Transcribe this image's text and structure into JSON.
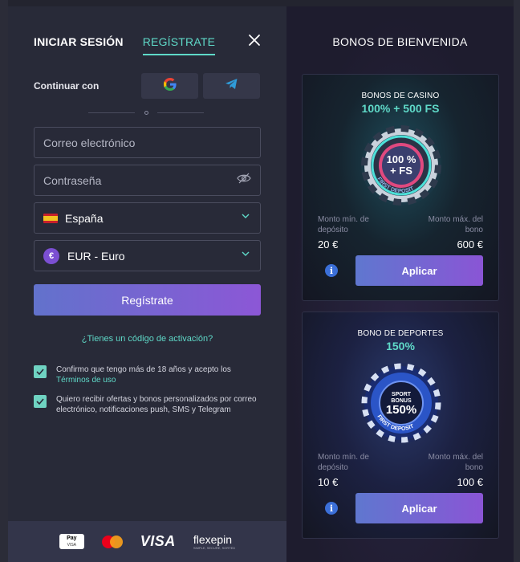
{
  "colors": {
    "accent_teal": "#5fd9c8",
    "button_gradient_start": "#6272cc",
    "button_gradient_end": "#8c57d6",
    "panel_bg": "#282a38"
  },
  "tabs": {
    "login": "INICIAR SESIÓN",
    "register": "REGÍSTRATE"
  },
  "icons": {
    "close": "close-icon",
    "google": "google-icon",
    "telegram": "telegram-icon",
    "eye": "eye-off-icon",
    "chevron": "chevron-down-icon",
    "info": "info-icon",
    "check": "check-icon"
  },
  "social": {
    "continue_label": "Continuar con"
  },
  "form": {
    "email_placeholder": "Correo electrónico",
    "password_placeholder": "Contraseña",
    "country_value": "España",
    "currency_value": "EUR - Euro",
    "currency_symbol": "€",
    "submit_label": "Regístrate",
    "activation_link": "¿Tienes un código de activación?"
  },
  "consents": {
    "age_text": "Confirmo que tengo más de 18 años y acepto los ",
    "terms_link": "Términos de uso",
    "marketing_text": "Quiero recibir ofertas y bonos personalizados por correo electrónico, notificaciones push, SMS y Telegram"
  },
  "payments": {
    "applepay_main": "Pay",
    "applepay_sub": "VISA",
    "visa": "VISA",
    "flexepin": "flexepin",
    "flexepin_sub": "SIMPLE, SECURE, SORTED"
  },
  "bonuses": {
    "title": "BONOS DE BIENVENIDA",
    "casino": {
      "label": "BONOS DE CASINO",
      "value": "100% + 500 FS",
      "chip_line1": "100 %",
      "chip_line2": "+ FS",
      "chip_ring": "FIRST DEPOSIT",
      "min_label": "Monto mín. de depósito",
      "max_label": "Monto máx. del bono",
      "min_value": "20 €",
      "max_value": "600 €",
      "apply_label": "Aplicar"
    },
    "sport": {
      "label": "BONO DE DEPORTES",
      "value": "150%",
      "chip_line1": "SPORT",
      "chip_line2": "BONUS",
      "chip_line3": "150%",
      "chip_ring": "FIRST DEPOSIT",
      "min_label": "Monto mín. de depósito",
      "max_label": "Monto máx. del bono",
      "min_value": "10 €",
      "max_value": "100 €",
      "apply_label": "Aplicar"
    }
  }
}
